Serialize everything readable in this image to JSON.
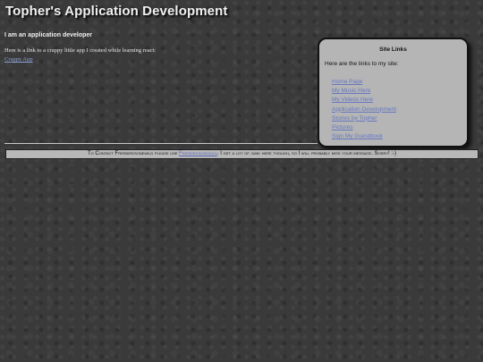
{
  "header": {
    "title": "Topher's Application Development"
  },
  "intro": {
    "heading": "I am an application developer",
    "text": "Here is a link to a crappy little app I created while learning react:",
    "link_label": "Crappy App"
  },
  "site_links": {
    "title": "Site Links",
    "subtitle": "Here are the links to my site:",
    "items": [
      {
        "label": "Home Page"
      },
      {
        "label": "My Music Here"
      },
      {
        "label": "My Videos Here"
      },
      {
        "label": "Application Development"
      },
      {
        "label": "Stories by Topher"
      },
      {
        "label": "Pictures"
      },
      {
        "label": "Sign My Guestbook"
      }
    ]
  },
  "contact": {
    "prefix": "To Contact Freebirdsonewild please use ",
    "link_label": "Freebirdsonewild",
    "suffix": ". I get a lot of junk here though, so I will probably miss your message. Sorry! :-)"
  },
  "colors": {
    "background": "#3a3a3a",
    "panel": "#b5b5b5",
    "link": "#6677c0"
  }
}
